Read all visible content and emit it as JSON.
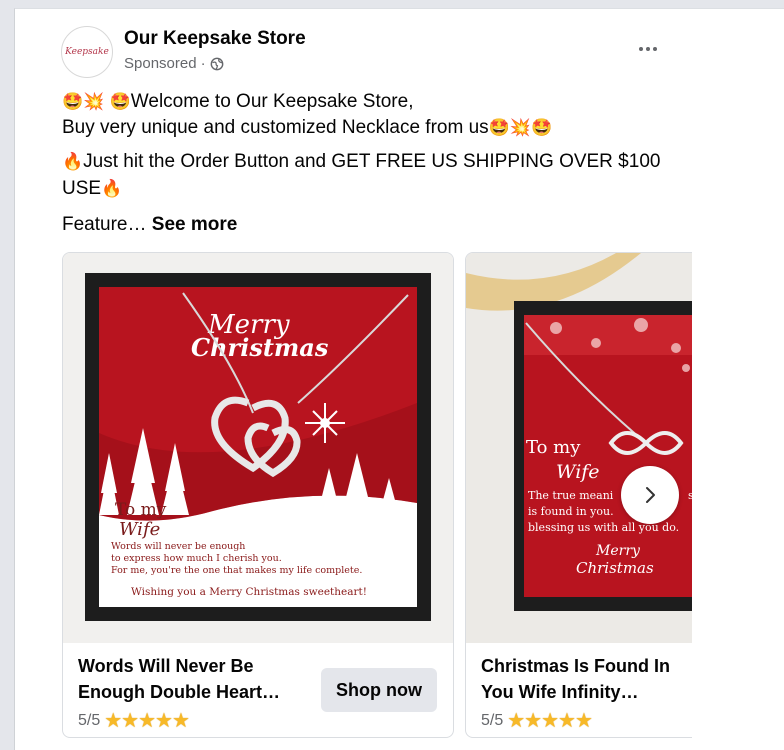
{
  "header": {
    "page_name": "Our Keepsake Store",
    "sponsored_label": "Sponsored",
    "separator": "·",
    "avatar_text": "Keepsake"
  },
  "post_text": {
    "line1": "Welcome to Our Keepsake Store,",
    "line2": "Buy very unique and customized Necklace from us",
    "line3": "Just hit the Order Button and GET FREE US SHIPPING OVER $100",
    "line4": "USE",
    "feature": "Feature…",
    "see_more": "See more"
  },
  "emojis": {
    "star_eyes": "🤩",
    "spark": "💥",
    "fire": "🔥"
  },
  "cards": [
    {
      "title_line1": "Words Will Never Be",
      "title_line2": "Enough Double Heart…",
      "rating": "5/5",
      "stars": "★★★★★",
      "button": "Shop now",
      "image": {
        "heading1": "Merry",
        "heading2": "Christmas",
        "to": "To my",
        "wife": "Wife",
        "msg1": "Words will never be enough",
        "msg2": "to express how much I cherish you.",
        "msg3": "For me, you're the one that makes my life complete.",
        "wish": "Wishing you a Merry Christmas sweetheart!"
      }
    },
    {
      "title_line1": "Christmas Is Found In",
      "title_line2": "You Wife Infinity…",
      "rating": "5/5",
      "stars": "★★★★★",
      "image": {
        "to": "To my",
        "wife": "Wife",
        "msg1": "The true meani",
        "msg1b": "str",
        "msg2": "is found in you.",
        "msg3": "blessing us with all you do.",
        "merry1": "Merry",
        "merry2": "Christmas"
      }
    }
  ],
  "colors": {
    "card_red": "#b8141f",
    "star": "#f7b928",
    "button_bg": "#e4e6eb"
  }
}
